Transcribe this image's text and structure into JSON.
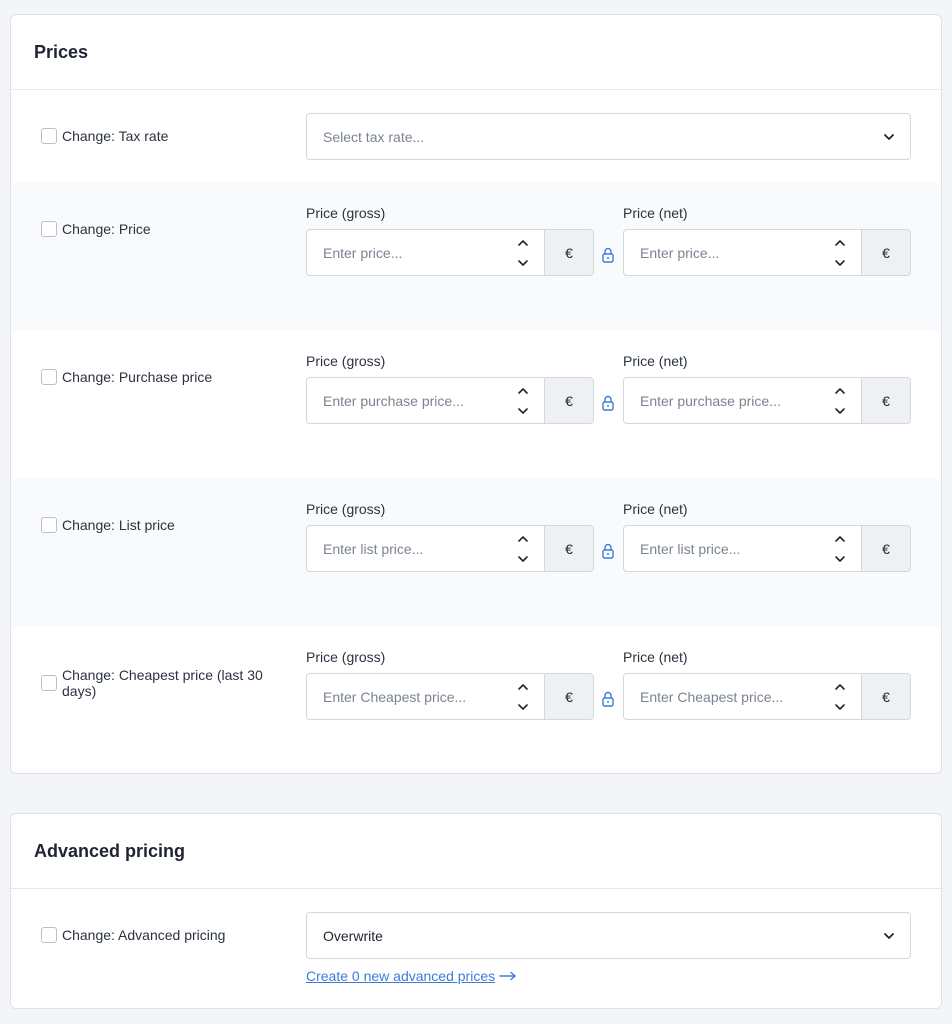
{
  "prices_card": {
    "title": "Prices",
    "tax_rate": {
      "checkbox_label": "Change: Tax rate",
      "select_placeholder": "Select tax rate..."
    },
    "rows": [
      {
        "checkbox_label": "Change: Price",
        "gross_label": "Price (gross)",
        "gross_placeholder": "Enter price...",
        "net_label": "Price (net)",
        "net_placeholder": "Enter price...",
        "currency": "€"
      },
      {
        "checkbox_label": "Change: Purchase price",
        "gross_label": "Price (gross)",
        "gross_placeholder": "Enter purchase price...",
        "net_label": "Price (net)",
        "net_placeholder": "Enter purchase price...",
        "currency": "€"
      },
      {
        "checkbox_label": "Change: List price",
        "gross_label": "Price (gross)",
        "gross_placeholder": "Enter list price...",
        "net_label": "Price (net)",
        "net_placeholder": "Enter list price...",
        "currency": "€"
      },
      {
        "checkbox_label": "Change: Cheapest price (last 30 days)",
        "gross_label": "Price (gross)",
        "gross_placeholder": "Enter Cheapest price...",
        "net_label": "Price (net)",
        "net_placeholder": "Enter Cheapest price...",
        "currency": "€"
      }
    ]
  },
  "advanced_card": {
    "title": "Advanced pricing",
    "checkbox_label": "Change: Advanced pricing",
    "select_value": "Overwrite",
    "link_text": "Create 0 new advanced prices"
  },
  "colors": {
    "accent": "#3d7bd9",
    "border": "#d1d8e0",
    "currency_bg": "#eef0f3"
  }
}
